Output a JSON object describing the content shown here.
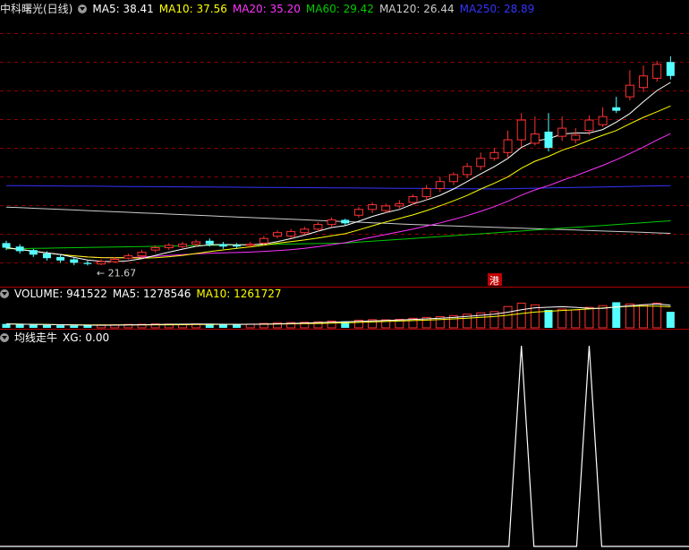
{
  "colors": {
    "background": "#000000",
    "up": "#ff3232",
    "down": "#54ffff",
    "grid": "#8b0000",
    "divider": "#b00000",
    "ma5": "#ffffff",
    "ma10": "#ffff00",
    "ma20": "#ff33ff",
    "ma60": "#00cc00",
    "ma120": "#cccccc",
    "ma250": "#3333ff"
  },
  "price_header": {
    "title": "中科曙光(日线)",
    "ma5": "MA5: 38.41",
    "ma10": "MA10: 37.56",
    "ma20": "MA20: 35.20",
    "ma60": "MA60: 29.42",
    "ma120": "MA120: 26.44",
    "ma250": "MA250: 28.89"
  },
  "low_marker": "← 21.67",
  "hk_badge": "港",
  "volume_header": {
    "volume": "VOLUME: 941522",
    "ma5": "MA5: 1278546",
    "ma10": "MA10: 1261727"
  },
  "indicator_header": {
    "name": "均线走牛",
    "xg": "XG: 0.00"
  },
  "chart_data": [
    {
      "type": "candlestick",
      "title": "中科曙光(日线)",
      "ylim": [
        20,
        43
      ],
      "x": [
        1,
        2,
        3,
        4,
        5,
        6,
        7,
        8,
        9,
        10,
        11,
        12,
        13,
        14,
        15,
        16,
        17,
        18,
        19,
        20,
        21,
        22,
        23,
        24,
        25,
        26,
        27,
        28,
        29,
        30,
        31,
        32,
        33,
        34,
        35,
        36,
        37,
        38,
        39,
        40,
        41,
        42,
        43,
        44,
        45,
        46,
        47,
        48,
        49,
        50
      ],
      "open": [
        23.6,
        23.3,
        23.0,
        22.7,
        22.4,
        22.2,
        21.9,
        21.8,
        22.0,
        22.3,
        22.5,
        23.0,
        23.2,
        23.3,
        23.5,
        23.8,
        23.5,
        23.4,
        23.4,
        23.6,
        24.2,
        24.2,
        24.5,
        24.8,
        25.2,
        25.6,
        26.0,
        26.5,
        26.4,
        26.8,
        27.1,
        27.6,
        28.3,
        28.9,
        29.5,
        30.2,
        30.9,
        31.4,
        32.5,
        32.2,
        33.2,
        32.8,
        32.5,
        33.3,
        33.8,
        35.3,
        36.2,
        37.0,
        37.8,
        39.2
      ],
      "close": [
        23.2,
        22.9,
        22.6,
        22.3,
        22.1,
        21.9,
        21.8,
        22.0,
        22.2,
        22.5,
        22.8,
        23.2,
        23.4,
        23.5,
        23.7,
        23.5,
        23.3,
        23.3,
        23.5,
        24.0,
        24.5,
        24.6,
        24.8,
        25.2,
        25.6,
        25.3,
        26.5,
        26.9,
        26.8,
        27.0,
        27.6,
        28.3,
        28.9,
        29.5,
        30.2,
        30.9,
        31.4,
        32.5,
        34.2,
        33.0,
        31.8,
        33.5,
        32.9,
        34.2,
        34.5,
        35.0,
        37.2,
        38.0,
        39.0,
        38.0
      ],
      "high": [
        23.8,
        23.5,
        23.1,
        22.9,
        22.6,
        22.4,
        22.1,
        22.2,
        22.4,
        22.7,
        23.0,
        23.4,
        23.6,
        23.7,
        23.9,
        24.0,
        23.7,
        23.6,
        23.7,
        24.2,
        24.7,
        24.8,
        25.0,
        25.4,
        25.8,
        25.7,
        26.7,
        27.1,
        27.0,
        27.3,
        27.8,
        28.6,
        29.3,
        29.7,
        30.5,
        31.4,
        31.8,
        33.3,
        34.8,
        34.5,
        34.8,
        34.5,
        33.5,
        34.6,
        35.3,
        36.2,
        38.5,
        38.9,
        39.3,
        39.7
      ],
      "low": [
        23.0,
        22.7,
        22.4,
        22.1,
        21.9,
        21.7,
        21.67,
        21.7,
        21.9,
        22.2,
        22.3,
        22.8,
        23.0,
        23.1,
        23.3,
        23.3,
        23.1,
        23.1,
        23.2,
        23.4,
        24.0,
        24.0,
        24.3,
        24.6,
        25.0,
        25.1,
        25.8,
        26.2,
        26.2,
        26.6,
        26.9,
        27.3,
        28.0,
        28.6,
        29.2,
        29.9,
        30.7,
        30.9,
        31.9,
        32.0,
        31.5,
        32.4,
        32.2,
        32.9,
        33.6,
        34.8,
        35.9,
        36.6,
        37.5,
        37.7
      ]
    },
    {
      "type": "bar",
      "title": "VOLUME",
      "x": [
        1,
        2,
        3,
        4,
        5,
        6,
        7,
        8,
        9,
        10,
        11,
        12,
        13,
        14,
        15,
        16,
        17,
        18,
        19,
        20,
        21,
        22,
        23,
        24,
        25,
        26,
        27,
        28,
        29,
        30,
        31,
        32,
        33,
        34,
        35,
        36,
        37,
        38,
        39,
        40,
        41,
        42,
        43,
        44,
        45,
        46,
        47,
        48,
        49,
        50
      ],
      "values": [
        230000,
        200000,
        180000,
        160000,
        150000,
        140000,
        150000,
        170000,
        180000,
        200000,
        210000,
        230000,
        220000,
        210000,
        230000,
        200000,
        190000,
        200000,
        220000,
        260000,
        300000,
        310000,
        330000,
        350000,
        400000,
        380000,
        450000,
        480000,
        470000,
        500000,
        560000,
        610000,
        660000,
        720000,
        800000,
        880000,
        950000,
        1250000,
        1450000,
        1350000,
        1050000,
        1100000,
        1050000,
        1200000,
        1300000,
        1500000,
        1400000,
        1350000,
        1450000,
        941522
      ],
      "ma5": 1278546,
      "ma10": 1261727
    },
    {
      "type": "line",
      "title": "均线走牛",
      "series": [
        {
          "name": "XG",
          "values": [
            0,
            0,
            0,
            0,
            0,
            0,
            0,
            0,
            0,
            0,
            0,
            0,
            0,
            0,
            0,
            0,
            0,
            0,
            0,
            0,
            0,
            0,
            0,
            0,
            0,
            0,
            0,
            0,
            0,
            0,
            0,
            0,
            0,
            0,
            0,
            0,
            0,
            0,
            1,
            0,
            0,
            0,
            0,
            1,
            0,
            0,
            0,
            0,
            0,
            0
          ]
        }
      ],
      "ylim": [
        0,
        1
      ]
    }
  ]
}
